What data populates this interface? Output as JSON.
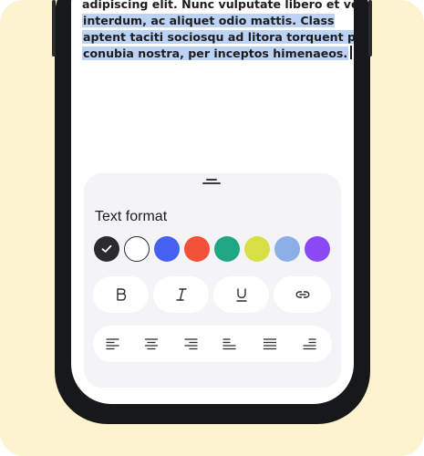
{
  "editor": {
    "text_line1": "adipiscing elit. Nunc vulputate libero et velit",
    "text_line2": "interdum, ac aliquet odio mattis. Class",
    "text_line3": "aptent taciti sociosqu ad litora torquent per",
    "text_line4": "conubia nostra, per inceptos himenaeos."
  },
  "format_sheet": {
    "title": "Text format",
    "colors": [
      "#2b2b2e",
      "#ffffff",
      "#4461f2",
      "#f2513a",
      "#1fa783",
      "#d8df44",
      "#8aaee6",
      "#8b49f6"
    ],
    "selected_color": "#2b2b2e",
    "style_buttons": [
      {
        "name": "bold",
        "glyph": "B"
      },
      {
        "name": "italic",
        "glyph": "I"
      },
      {
        "name": "underline",
        "glyph": "U"
      },
      {
        "name": "link",
        "glyph": "link-icon"
      }
    ],
    "align_buttons": [
      "align-left",
      "align-center",
      "align-right",
      "align-bottom-left",
      "align-justify",
      "align-bottom-right"
    ]
  }
}
